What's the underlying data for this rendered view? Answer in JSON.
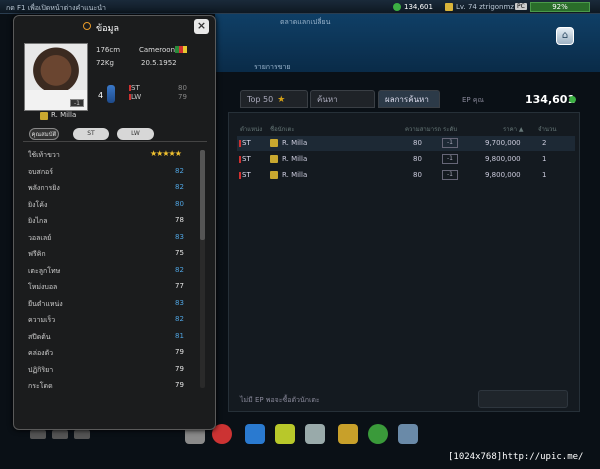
{
  "topbar": {
    "hint": "กด F1 เพื่อเปิดหน้าต่างคำแนะนำ",
    "coins": "134,601",
    "level": "Lv. 74 ztrigonmz",
    "pc_badge": "PC",
    "battery": "92%"
  },
  "market": {
    "title": "ตลาดแลกเปลี่ยน",
    "subtitle": "รายการขาย",
    "tabs": {
      "top50": "Top 50",
      "search": "ค้นหา",
      "results": "ผลการค้นหา"
    },
    "ep_label": "EP คุณ",
    "ep_value": "134,601",
    "columns": [
      "ตำแหน่ง",
      "ชื่อนักเตะ",
      "ความสามารถ",
      "ระดับ",
      "ราคา ▲",
      "จำนวน"
    ],
    "rows": [
      {
        "pos": "ST",
        "name": "R. Milla",
        "ovr": "80",
        "chip": "-1",
        "price": "9,700,000",
        "count": "2"
      },
      {
        "pos": "ST",
        "name": "R. Milla",
        "ovr": "80",
        "chip": "-1",
        "price": "9,800,000",
        "count": "1"
      },
      {
        "pos": "ST",
        "name": "R. Milla",
        "ovr": "80",
        "chip": "-1",
        "price": "9,800,000",
        "count": "1"
      }
    ],
    "empty_msg": "ไม่มี EP พอจะซื้อตัวนักเตะ"
  },
  "modal": {
    "title": "ข้อมูล",
    "close": "×",
    "player_name": "R. Milla",
    "height": "176cm",
    "weight": "72Kg",
    "nation": "Cameroon",
    "dob": "20.5.1952",
    "level_num": "4",
    "positions": [
      {
        "pos": "ST",
        "ovr": "80"
      },
      {
        "pos": "LW",
        "ovr": "79"
      }
    ],
    "photo_badge": "-1",
    "tabs": {
      "overall": "คุณสมบัติ",
      "st": "ST",
      "lw": "LW"
    },
    "stats": [
      {
        "label": "ใช้เท้าขวา",
        "value": "★★★★★",
        "type": "stars"
      },
      {
        "label": "จบสกอร์",
        "value": "82",
        "type": "blue"
      },
      {
        "label": "พลังการยิง",
        "value": "82",
        "type": "blue"
      },
      {
        "label": "ยิงโค้ง",
        "value": "80",
        "type": "blue"
      },
      {
        "label": "ยิงไกล",
        "value": "78",
        "type": "white"
      },
      {
        "label": "วอลเลย์",
        "value": "83",
        "type": "blue"
      },
      {
        "label": "ฟรีคิก",
        "value": "75",
        "type": "white"
      },
      {
        "label": "เตะลูกโทษ",
        "value": "82",
        "type": "blue"
      },
      {
        "label": "โหม่งบอล",
        "value": "77",
        "type": "white"
      },
      {
        "label": "ยืนตำแหน่ง",
        "value": "83",
        "type": "blue"
      },
      {
        "label": "ความเร็ว",
        "value": "82",
        "type": "blue"
      },
      {
        "label": "สปีดต้น",
        "value": "81",
        "type": "blue"
      },
      {
        "label": "คล่องตัว",
        "value": "79",
        "type": "white"
      },
      {
        "label": "ปฏิกิริยา",
        "value": "79",
        "type": "white"
      },
      {
        "label": "กระโดด",
        "value": "79",
        "type": "white"
      }
    ]
  },
  "watermark": "[1024x768]http://upic.me/"
}
